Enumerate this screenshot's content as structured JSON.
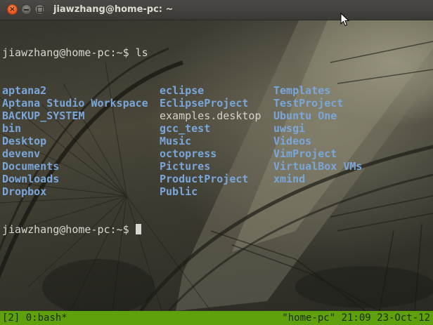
{
  "window": {
    "title": "jiawzhang@home-pc: ~"
  },
  "terminal": {
    "prompt": "jiawzhang@home-pc:~$",
    "command": " ls",
    "rows": [
      [
        {
          "text": "aptana2",
          "kind": "dir"
        },
        {
          "text": "eclipse",
          "kind": "dir"
        },
        {
          "text": "Templates",
          "kind": "dir"
        }
      ],
      [
        {
          "text": "Aptana Studio Workspace",
          "kind": "dir"
        },
        {
          "text": "EclipseProject",
          "kind": "dir"
        },
        {
          "text": "TestProject",
          "kind": "dir"
        }
      ],
      [
        {
          "text": "BACKUP_SYSTEM",
          "kind": "dir"
        },
        {
          "text": "examples.desktop",
          "kind": "file"
        },
        {
          "text": "Ubuntu One",
          "kind": "dir"
        }
      ],
      [
        {
          "text": "bin",
          "kind": "dir"
        },
        {
          "text": "gcc_test",
          "kind": "dir"
        },
        {
          "text": "uwsgi",
          "kind": "dir"
        }
      ],
      [
        {
          "text": "Desktop",
          "kind": "dir"
        },
        {
          "text": "Music",
          "kind": "dir"
        },
        {
          "text": "Videos",
          "kind": "dir"
        }
      ],
      [
        {
          "text": "devenv",
          "kind": "dir"
        },
        {
          "text": "octopress",
          "kind": "dir"
        },
        {
          "text": "VimProject",
          "kind": "dir"
        }
      ],
      [
        {
          "text": "Documents",
          "kind": "dir"
        },
        {
          "text": "Pictures",
          "kind": "dir"
        },
        {
          "text": "VirtualBox VMs",
          "kind": "dir"
        }
      ],
      [
        {
          "text": "Downloads",
          "kind": "dir"
        },
        {
          "text": "ProductProject",
          "kind": "dir"
        },
        {
          "text": "xmind",
          "kind": "dir"
        }
      ],
      [
        {
          "text": "Dropbox",
          "kind": "dir"
        },
        {
          "text": "Public",
          "kind": "dir"
        },
        {
          "text": "",
          "kind": "dir"
        }
      ]
    ],
    "prompt2": "jiawzhang@home-pc:~$ "
  },
  "statusbar": {
    "left": "[2] 0:bash*",
    "right": "\"home-pc\" 21:09 23-Oct-12"
  },
  "colors": {
    "directory": "#7aa6da",
    "file": "#d3d3cb",
    "status_bg": "#5ea10c",
    "close_button": "#e5531d"
  }
}
